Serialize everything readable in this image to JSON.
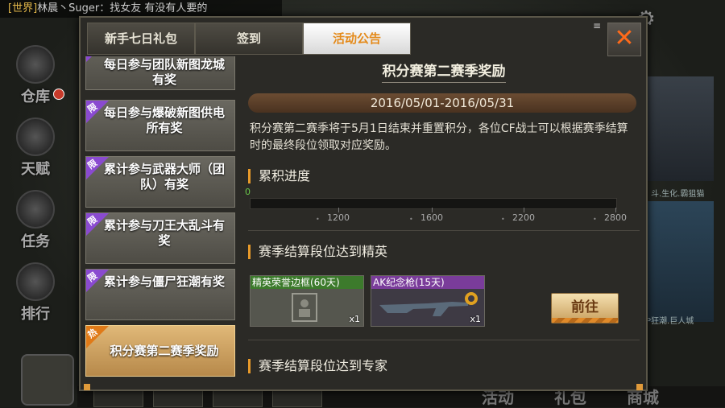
{
  "background": {
    "chat_channel": "[世界]",
    "chat_text": "林晨丶Suger：找女友 有没有人要的",
    "nav": [
      "仓库",
      "天赋",
      "任务",
      "排行"
    ],
    "right_texts": [
      "斗.生化.霸狙猫",
      "P狂潮.巨人城"
    ],
    "bottom_labels": [
      "活动",
      "礼包",
      "商城"
    ]
  },
  "tabs": [
    "新手七日礼包",
    "签到",
    "活动公告"
  ],
  "active_tab": 2,
  "menu_icon": "menu-icon",
  "close_label": "✕",
  "sidebar": {
    "items": [
      {
        "label": "每日参与团队新图龙城有奖",
        "badge": "限"
      },
      {
        "label": "每日参与爆破新图供电所有奖",
        "badge": "限"
      },
      {
        "label": "累计参与武器大师（团队）有奖",
        "badge": "限"
      },
      {
        "label": "累计参与刀王大乱斗有奖",
        "badge": "限"
      },
      {
        "label": "累计参与僵尸狂潮有奖",
        "badge": "限"
      },
      {
        "label": "积分赛第二赛季奖励",
        "badge": "热",
        "active": true
      }
    ]
  },
  "content": {
    "title": "积分赛第二赛季奖励",
    "date_range": "2016/05/01-2016/05/31",
    "description": "积分赛第二赛季将于5月1日结束并重置积分，各位CF战士可以根据赛季结算时的最终段位领取对应奖励。",
    "progress_heading": "累积进度",
    "progress_value": "0",
    "progress_fraction": 0,
    "ticks": [
      "1200",
      "1600",
      "2200",
      "2800"
    ],
    "section1": "赛季结算段位达到精英",
    "rewards": [
      {
        "name": "精英荣誉边框(60天)",
        "qty": "x1",
        "color": "#3c7a2c"
      },
      {
        "name": "AK纪念枪(15天)",
        "qty": "x1",
        "color": "#7a3c9a"
      }
    ],
    "go_label": "前往",
    "section2": "赛季结算段位达到专家"
  }
}
